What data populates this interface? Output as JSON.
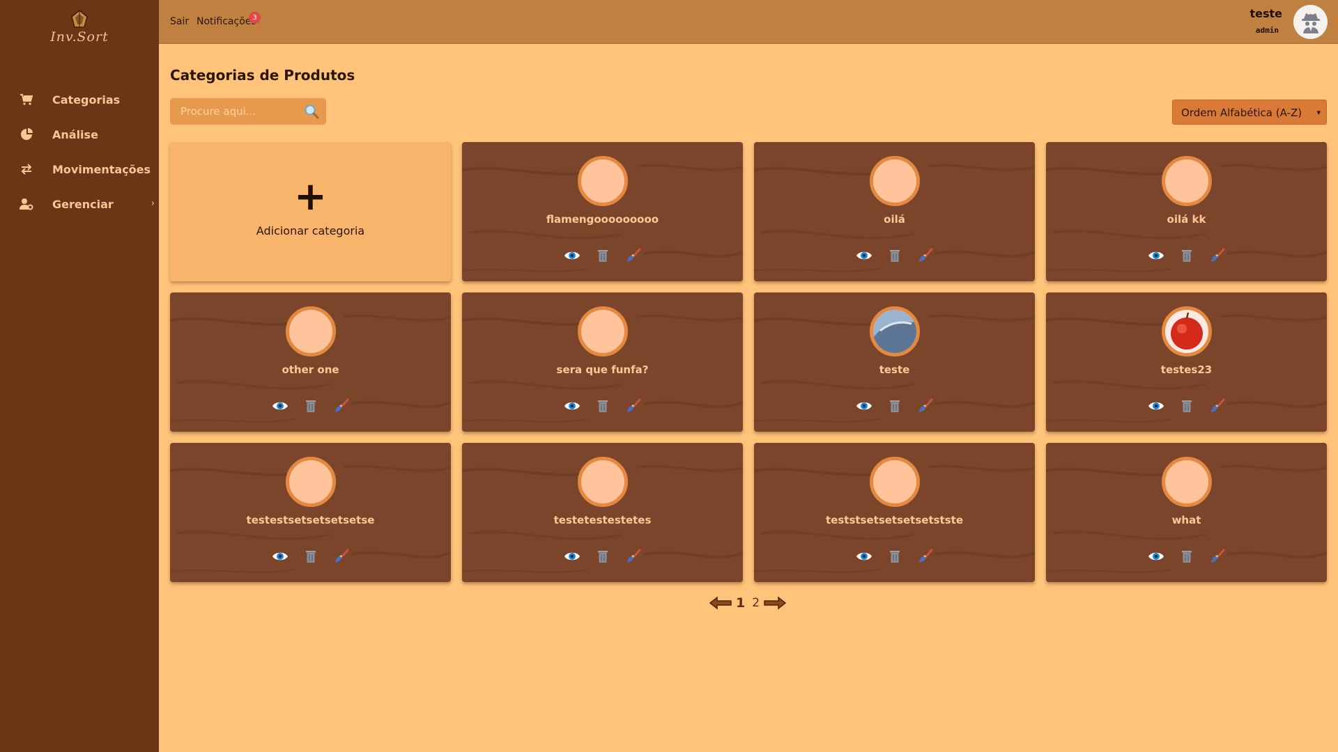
{
  "brand": {
    "logo_text": "Inv.Sort"
  },
  "sidebar": {
    "items": [
      {
        "label": "Categorias",
        "icon": "cart-icon"
      },
      {
        "label": "Análise",
        "icon": "pie-chart-icon"
      },
      {
        "label": "Movimentações",
        "icon": "swap-arrows-icon"
      },
      {
        "label": "Gerenciar",
        "icon": "user-gear-icon"
      }
    ]
  },
  "topbar": {
    "logout_label": "Sair",
    "notifications_label": "Notificações",
    "notifications_count": "3",
    "user_name": "teste",
    "user_role": "admin"
  },
  "main": {
    "title": "Categorias de Produtos",
    "search_placeholder": "Procure aqui...",
    "sort_selected": "Ordem Alfabética (A-Z)",
    "add_label": "Adicionar categoria",
    "categories": [
      {
        "name": "flamengooooooooo",
        "image": "placeholder"
      },
      {
        "name": "oilá",
        "image": "placeholder"
      },
      {
        "name": "oilá kk",
        "image": "placeholder"
      },
      {
        "name": "other one",
        "image": "placeholder"
      },
      {
        "name": "sera que funfa?",
        "image": "placeholder"
      },
      {
        "name": "teste",
        "image": "sky-photo"
      },
      {
        "name": "testes23",
        "image": "apple-photo"
      },
      {
        "name": "testestsetsetsetsetse",
        "image": "placeholder"
      },
      {
        "name": "testetestestetes",
        "image": "placeholder"
      },
      {
        "name": "teststsetsetsetsetstste",
        "image": "placeholder"
      },
      {
        "name": "what",
        "image": "placeholder"
      }
    ]
  },
  "pagination": {
    "current": "1",
    "next": "2"
  },
  "colors": {
    "sidebar": "#6b3616",
    "topbar": "#c08040",
    "background": "#ffc37a",
    "card_wood": "#7a452b",
    "card_add": "#f8b46a",
    "thumb_ring": "#e48a40",
    "badge": "#e04848"
  }
}
